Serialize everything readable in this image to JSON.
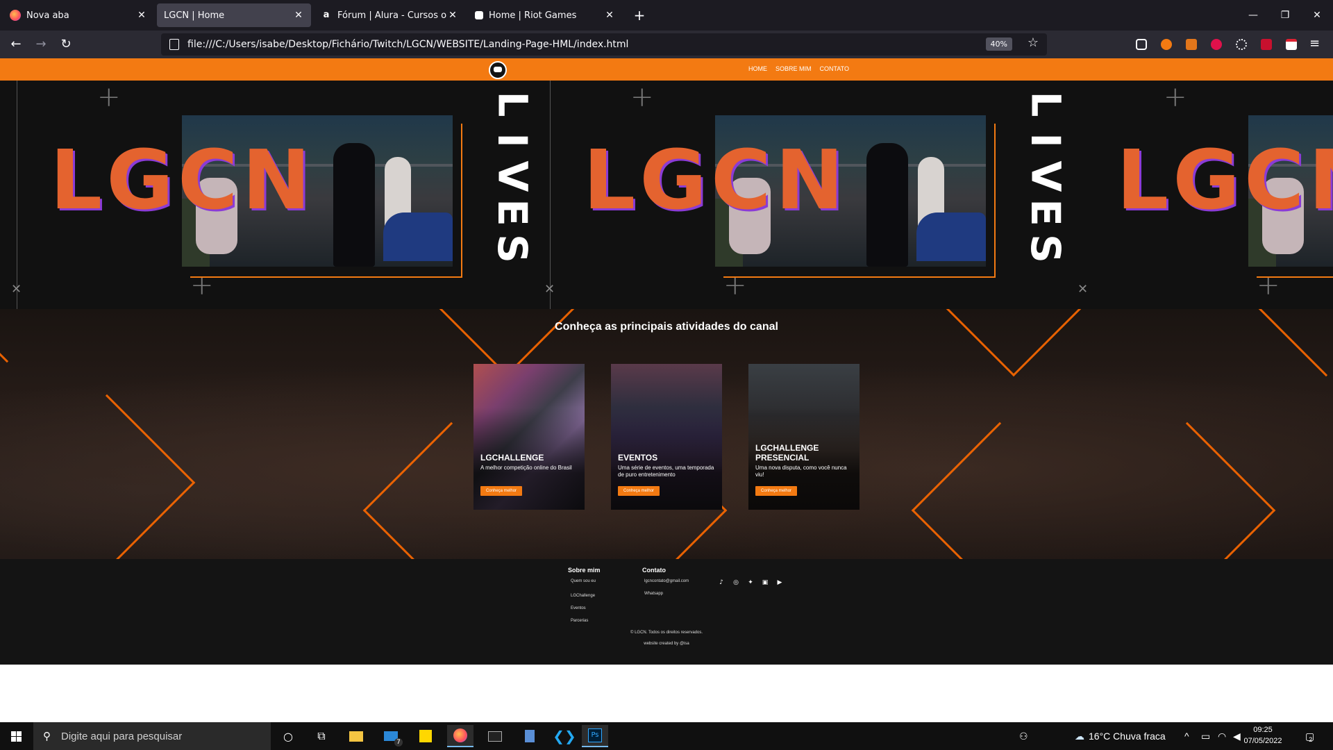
{
  "browser": {
    "tabs": [
      {
        "title": "Nova aba",
        "active": false
      },
      {
        "title": "LGCN | Home",
        "active": true
      },
      {
        "title": "Fórum | Alura - Cursos online de",
        "active": false
      },
      {
        "title": "Home | Riot Games",
        "active": false
      }
    ],
    "new_tab": "+",
    "url": "file:///C:/Users/isabe/Desktop/Fichário/Twitch/LGCN/WEBSITE/Landing-Page-HML/index.html",
    "zoom": "40%",
    "extensions": [
      "pocket-icon",
      "rss-icon",
      "fox-icon",
      "abp-icon",
      "gear-ext-icon",
      "pin-ext-icon",
      "calendar-ext-icon"
    ]
  },
  "site": {
    "nav": [
      "HOME",
      "SOBRE MIM",
      "CONTATO"
    ],
    "banner": {
      "logo_text": "LGCN",
      "side_text": [
        "L",
        "I",
        "V",
        "E",
        "S"
      ]
    },
    "activities": {
      "title": "Conheça as principais atividades do canal",
      "cards": [
        {
          "title": "LGCHALLENGE",
          "desc": "A melhor competição online do Brasil",
          "button": "Conheça melhor"
        },
        {
          "title": "EVENTOS",
          "desc": "Uma série de eventos, uma temporada de puro entretenimento",
          "button": "Conheça melhor"
        },
        {
          "title": "LGCHALLENGE PRESENCIAL",
          "desc": "Uma nova disputa, como você nunca viu!",
          "button": "Conheça melhor"
        }
      ]
    },
    "footer": {
      "about_heading": "Sobre mim",
      "about_links": [
        "Quem sou eu",
        "LGChallenge",
        "Eventos",
        "Parcerias"
      ],
      "contact_heading": "Contato",
      "contact_links": [
        "lgcncontato@gmail.com",
        "Whatsapp"
      ],
      "social": [
        "tiktok-icon",
        "instagram-icon",
        "twitter-icon",
        "twitch-icon",
        "youtube-icon"
      ],
      "copyright": "© LGCN. Todos os direitos reservados.",
      "credit": "website created by @isa"
    }
  },
  "taskbar": {
    "search_placeholder": "Digite aqui para pesquisar",
    "weather": "16°C  Chuva fraca",
    "time": "09:25",
    "date": "07/05/2022",
    "notifications": "2",
    "mail_badge": "7"
  },
  "colors": {
    "accent": "#f37a12",
    "browser_bg": "#1c1b22",
    "toolbar": "#2b2a33"
  }
}
